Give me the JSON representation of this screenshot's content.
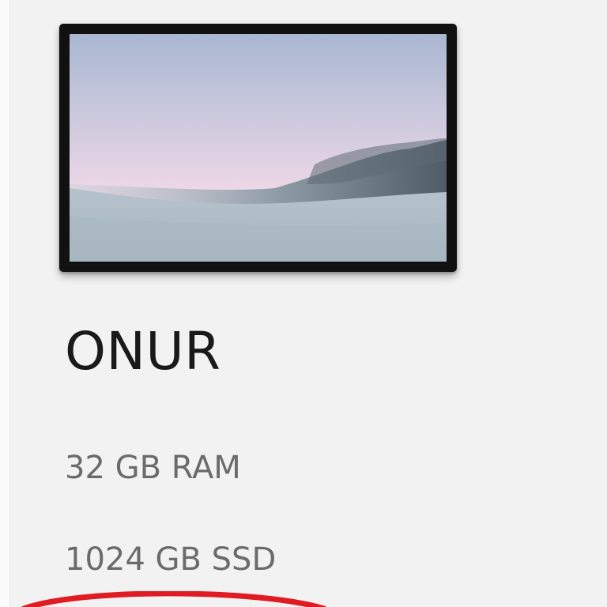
{
  "device": {
    "name": "ONUR",
    "specs": {
      "ram": "32 GB RAM",
      "storage": "1024 GB SSD"
    }
  },
  "colors": {
    "background": "#f2f2f2",
    "frame": "#111111",
    "name_text": "#1a1a1a",
    "spec_text": "#6b6b6b",
    "annotation_stroke": "#e11b22"
  }
}
